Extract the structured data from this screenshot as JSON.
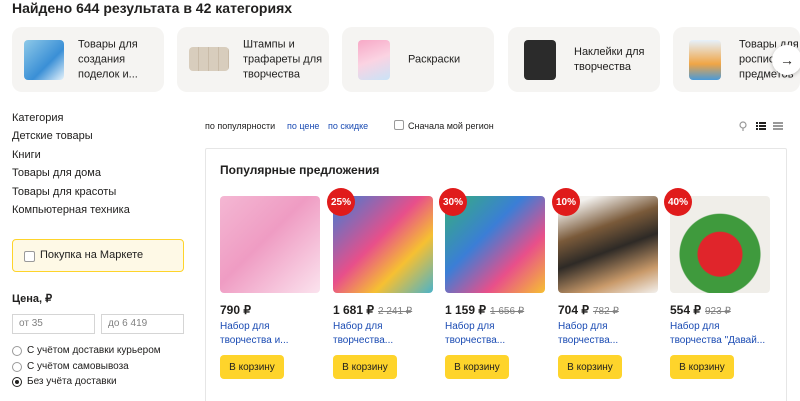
{
  "results": {
    "title": "Найдено 644 результата в 42 категориях"
  },
  "categories": [
    {
      "label": "Товары для создания поделок и..."
    },
    {
      "label": "Штампы и трафареты для творчества"
    },
    {
      "label": "Раскраски"
    },
    {
      "label": "Наклейки для творчества"
    },
    {
      "label": "Товары для росписи предметов"
    }
  ],
  "sidebar": {
    "heading": "Категория",
    "links": [
      "Детские товары",
      "Книги",
      "Товары для дома",
      "Товары для красоты",
      "Компьютерная техника"
    ],
    "market_checkbox": "Покупка на Маркете",
    "price_title": "Цена, ₽",
    "price_from_placeholder": "от 35",
    "price_to_placeholder": "до 6 419",
    "delivery": [
      "С учётом доставки курьером",
      "С учётом самовывоза",
      "Без учёта доставки"
    ],
    "delivery_selected": 2
  },
  "sort": {
    "options": [
      "по популярности",
      "по цене",
      "по скидке"
    ],
    "region": "Сначала мой регион"
  },
  "offers": {
    "title": "Популярные предложения",
    "cart_label": "В корзину",
    "items": [
      {
        "price": "790 ₽",
        "old_price": "",
        "badge": "",
        "name": "Набор для творчества и..."
      },
      {
        "price": "1 681 ₽",
        "old_price": "2 241 ₽",
        "badge": "25%",
        "name": "Набор для творчества..."
      },
      {
        "price": "1 159 ₽",
        "old_price": "1 656 ₽",
        "badge": "30%",
        "name": "Набор для творчества..."
      },
      {
        "price": "704 ₽",
        "old_price": "782 ₽",
        "badge": "10%",
        "name": "Набор для творчества..."
      },
      {
        "price": "554 ₽",
        "old_price": "923 ₽",
        "badge": "40%",
        "name": "Набор для творчества \"Давай..."
      }
    ]
  },
  "colors": {
    "accent": "#fed42b",
    "link": "#1a4bb3",
    "sale": "#e01b1b"
  }
}
